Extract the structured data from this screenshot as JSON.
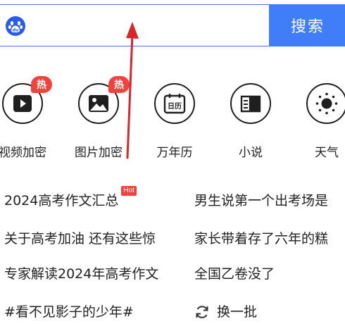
{
  "search": {
    "value": "",
    "button_label": "搜索",
    "logo_icon": "baidu-paw-icon"
  },
  "features": [
    {
      "label": "视频加密",
      "icon": "play-icon",
      "badge": "热"
    },
    {
      "label": "图片加密",
      "icon": "image-icon",
      "badge": "热"
    },
    {
      "label": "万年历",
      "icon": "calendar-icon",
      "icon_text": "日历"
    },
    {
      "label": "小说",
      "icon": "book-icon"
    },
    {
      "label": "天气",
      "icon": "sun-icon"
    }
  ],
  "hot_list": {
    "left": [
      {
        "text": "2024高考作文汇总",
        "tag": "Hot"
      },
      {
        "text": "关于高考加油 还有这些惊"
      },
      {
        "text": "专家解读2024年高考作文"
      },
      {
        "text": "#看不见影子的少年#"
      }
    ],
    "right": [
      {
        "text": "男生说第一个出考场是"
      },
      {
        "text": "家长带着存了六年的糕"
      },
      {
        "text": "全国乙卷没了"
      }
    ],
    "refresh_label": "换一批"
  },
  "colors": {
    "accent": "#3f7ef8",
    "badge": "#f0433c",
    "annotation_arrow": "#d9262a"
  }
}
